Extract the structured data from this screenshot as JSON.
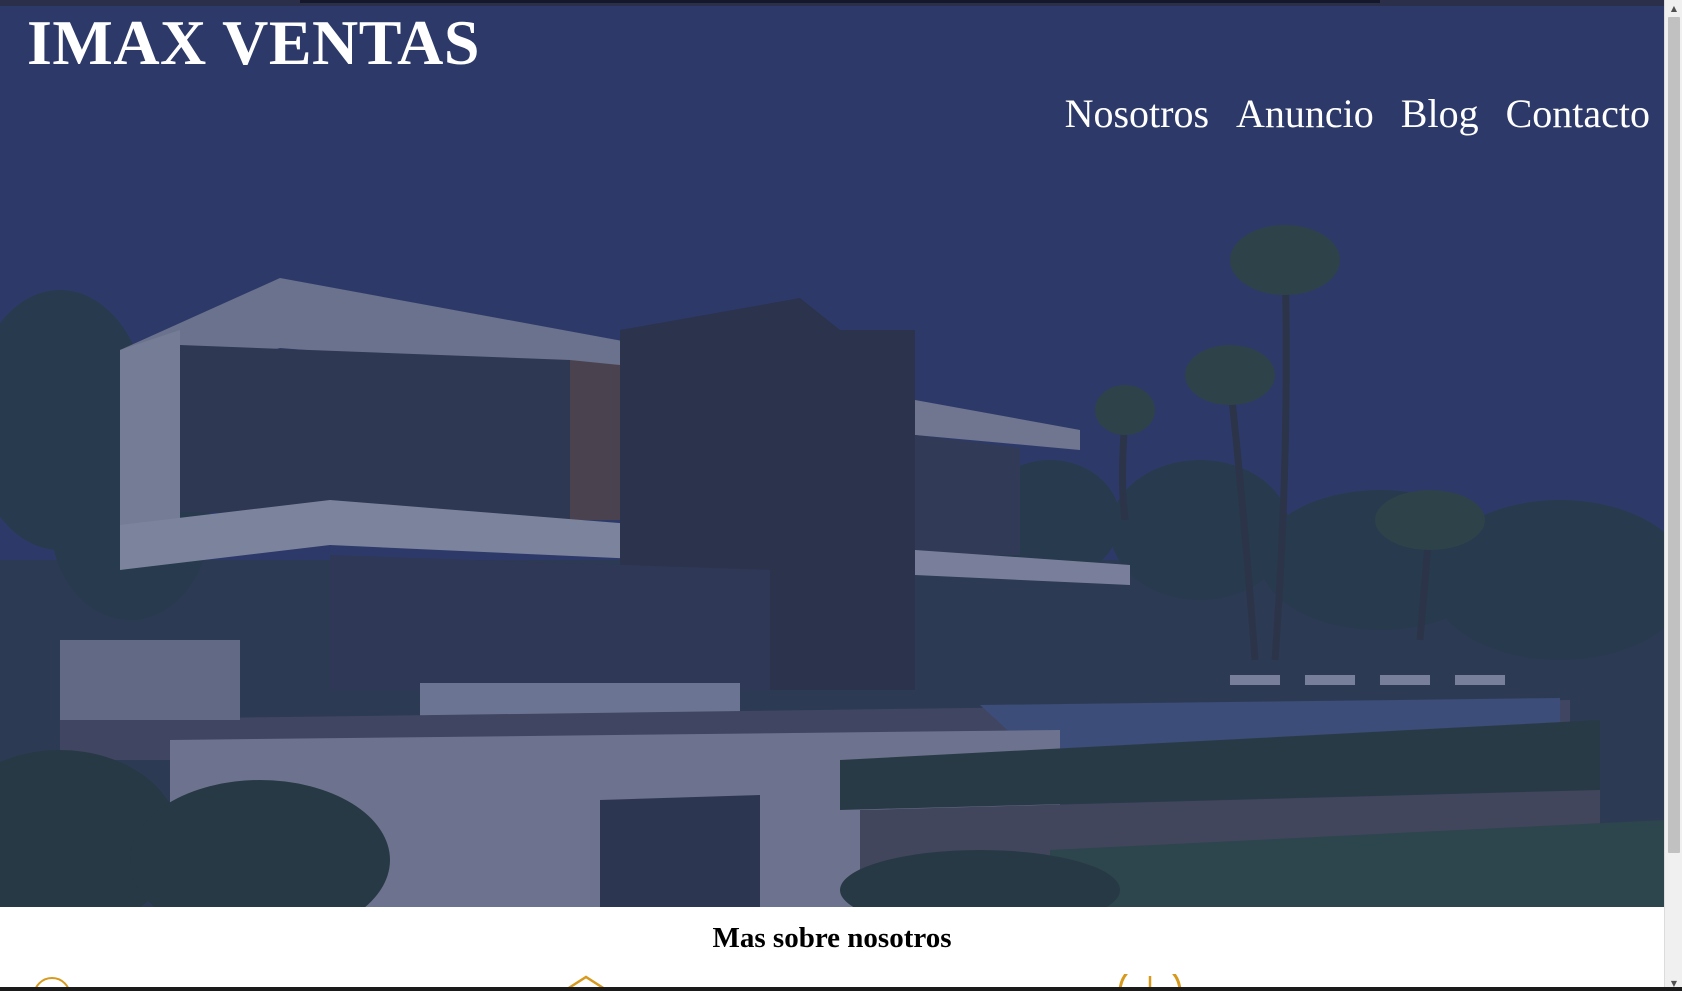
{
  "header": {
    "logo": "IMAX VENTAS",
    "nav": [
      {
        "label": "Nosotros"
      },
      {
        "label": "Anuncio"
      },
      {
        "label": "Blog"
      },
      {
        "label": "Contacto"
      }
    ]
  },
  "hero": {
    "image": "modern-villa-night-photo"
  },
  "about": {
    "title": "Mas sobre nosotros",
    "icons": [
      "circle-icon",
      "house-icon",
      "wheel-icon"
    ]
  },
  "colors": {
    "hero_overlay": "#2f3b6a",
    "accent": "#d79a1c",
    "text_light": "#ffffff",
    "text_dark": "#000000"
  }
}
